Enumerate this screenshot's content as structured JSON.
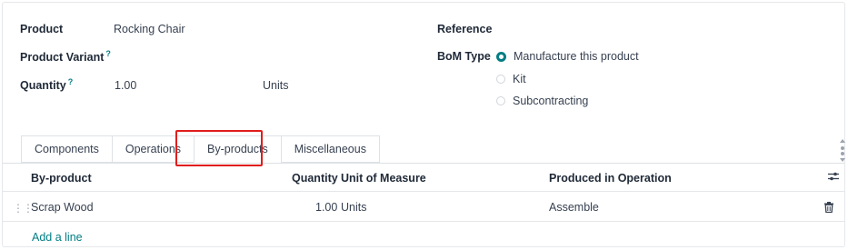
{
  "form": {
    "product_label": "Product",
    "product_value": "Rocking Chair",
    "variant_label": "Product Variant",
    "variant_help": "?",
    "quantity_label": "Quantity",
    "quantity_help": "?",
    "quantity_value": "1.00",
    "quantity_uom": "Units",
    "reference_label": "Reference",
    "bom_type_label": "BoM Type",
    "bom_type_options": [
      "Manufacture this product",
      "Kit",
      "Subcontracting"
    ],
    "bom_type_selected": "Manufacture this product"
  },
  "tabs": [
    "Components",
    "Operations",
    "By-products",
    "Miscellaneous"
  ],
  "active_tab": "By-products",
  "table": {
    "headers": {
      "byproduct": "By-product",
      "quantity": "Quantity",
      "uom": "Unit of Measure",
      "operation": "Produced in Operation"
    },
    "rows": [
      {
        "byproduct": "Scrap Wood",
        "quantity": "1.00",
        "uom": "Units",
        "operation": "Assemble"
      }
    ],
    "add_line": "Add a line"
  },
  "icons": {
    "drag": "drag-handle-icon",
    "delete": "trash-icon",
    "optional_columns": "sliders-icon"
  },
  "colors": {
    "accent": "#017e84",
    "highlight": "#e11d1d"
  }
}
